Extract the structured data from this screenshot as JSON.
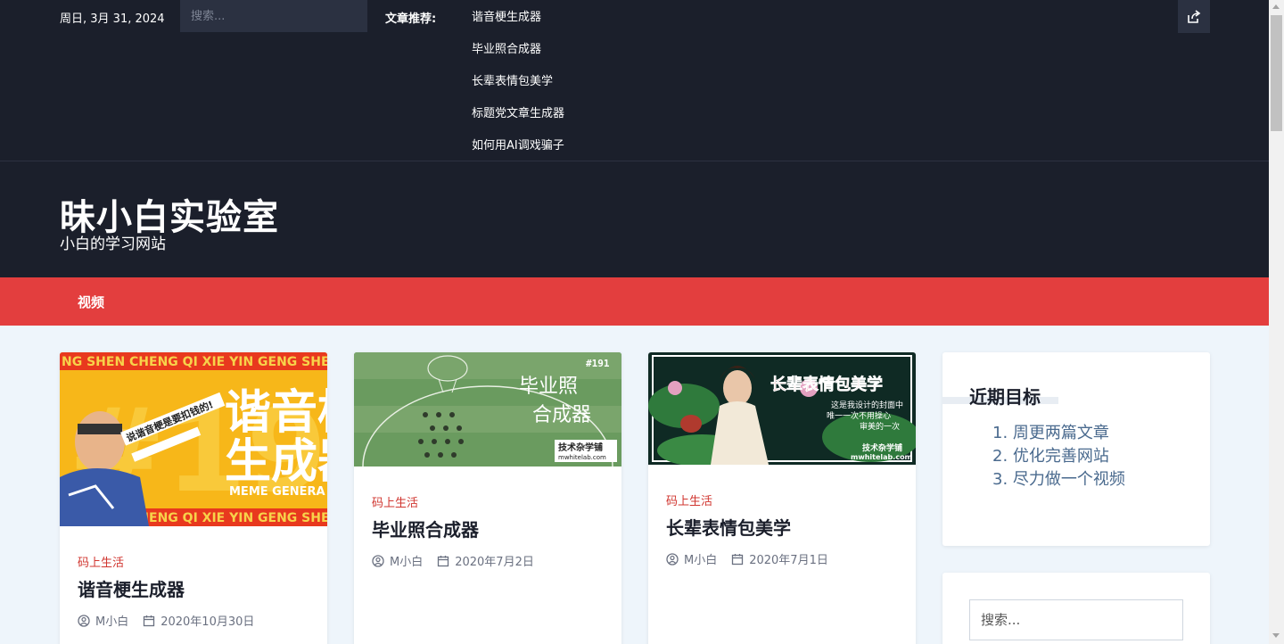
{
  "topbar": {
    "date": "周日, 3月 31, 2024",
    "search_placeholder": "搜索...",
    "recommend_label": "文章推荐:",
    "recommend_links": [
      "谐音梗生成器",
      "毕业照合成器",
      "长辈表情包美学",
      "标题党文章生成器",
      "如何用AI调戏骗子"
    ]
  },
  "header": {
    "title": "昧小白实验室",
    "tagline": "小白的学习网站"
  },
  "nav": {
    "items": [
      "视频"
    ]
  },
  "posts": [
    {
      "category": "码上生活",
      "title": "谐音梗生成器",
      "author": "M小白",
      "date": "2020年10月30日",
      "thumb_band_text": "NG SHEN CHENG QI XIE YIN GENG SHEN",
      "thumb_big_text_1": "谐音梗",
      "thumb_big_text_2": "生成器",
      "thumb_sub_text": "MEME GENERA"
    },
    {
      "category": "码上生活",
      "title": "毕业照合成器",
      "author": "M小白",
      "date": "2020年7月2日",
      "thumb_number": "#191",
      "thumb_text_1": "毕业照",
      "thumb_text_2": "合成器",
      "thumb_badge": "技术杂学铺",
      "thumb_site": "mwhitelab.com"
    },
    {
      "category": "码上生活",
      "title": "长辈表情包美学",
      "author": "M小白",
      "date": "2020年7月1日",
      "thumb_text": "长辈表情包美学",
      "thumb_caption_1": "这是我设计的封面中",
      "thumb_caption_2": "唯一一次不用操心",
      "thumb_caption_3": "审美的一次",
      "thumb_badge": "技术杂学铺",
      "thumb_site": "mwhitelab.com"
    }
  ],
  "sidebar": {
    "goals_title": "近期目标",
    "goals": [
      "1. 周更两篇文章",
      "2. 优化完善网站",
      "3. 尽力做一个视频"
    ],
    "search_placeholder": "搜索..."
  },
  "colors": {
    "dark_bg": "#1b1f2b",
    "accent_red": "#e33e3e",
    "page_bg": "#eef5fb",
    "category_red": "#d0352f"
  },
  "icons": {
    "share": "share-icon",
    "author": "user-circle-icon",
    "date": "calendar-icon"
  }
}
